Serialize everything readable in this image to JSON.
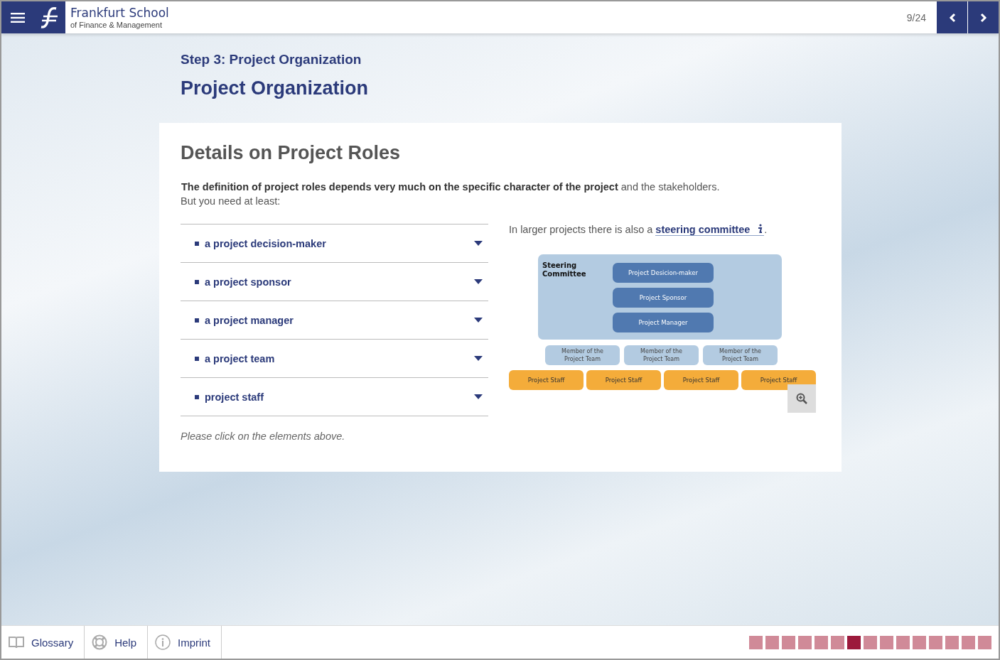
{
  "header": {
    "brand": "Frankfurt School",
    "brand_sub": "of Finance & Management",
    "page_counter": "9/24"
  },
  "step_title": "Step 3: Project Organization",
  "page_title": "Project Organization",
  "card": {
    "heading": "Details on Project Roles",
    "intro": "**The definition of project roles depends very much on the specific character of the project** and the stakeholders.",
    "intro_2": "But you need at least:",
    "roles": [
      {
        "label": "a project decision-maker",
        "expanded": false
      },
      {
        "label": "a project sponsor",
        "expanded": false
      },
      {
        "label": "a project manager",
        "expanded": false
      },
      {
        "label": "a project team",
        "expanded": false
      },
      {
        "label": "project staff",
        "expanded": false
      }
    ],
    "hint": "Please click on the elements above.",
    "aside_text": "In larger projects there is also a",
    "aside_link": "steering committee",
    "aside_end": ".",
    "org_chart": {
      "committee_label": "Steering Committee",
      "committee_roles": [
        "Project Desicion-maker",
        "Project Sponsor",
        "Project Manager"
      ],
      "team_members": [
        "Member of the Project Team",
        "Member of the Project Team",
        "Member of the Project Team"
      ],
      "staff": [
        "Project Staff",
        "Project Staff",
        "Project Staff",
        "Project Staff"
      ]
    }
  },
  "footer": {
    "links": [
      {
        "kind": "book",
        "label": "Glossary"
      },
      {
        "kind": "lifebuoy",
        "label": "Help"
      },
      {
        "kind": "info",
        "label": "Imprint"
      }
    ],
    "progress": [
      {
        "selected": false
      },
      {
        "selected": false
      },
      {
        "selected": false
      },
      {
        "selected": false
      },
      {
        "selected": false
      },
      {
        "selected": false
      },
      {
        "selected": true
      },
      {
        "selected": false
      },
      {
        "selected": false
      },
      {
        "selected": false
      },
      {
        "selected": false
      },
      {
        "selected": false
      },
      {
        "selected": false
      },
      {
        "selected": false
      },
      {
        "selected": false
      }
    ]
  }
}
